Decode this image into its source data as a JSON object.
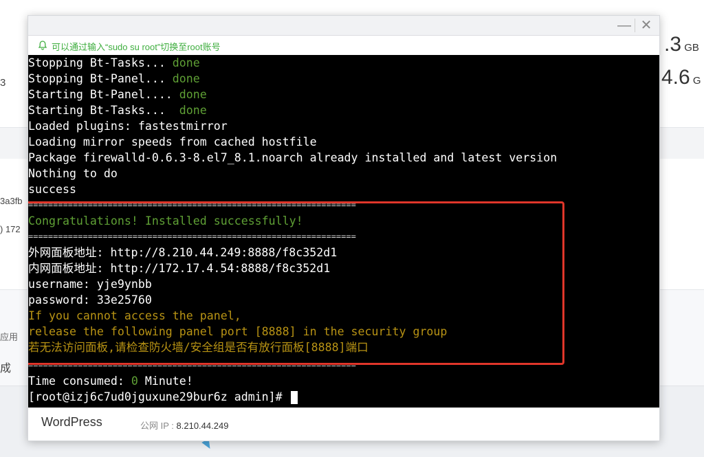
{
  "background": {
    "stat_1_value": ".3",
    "stat_1_unit": "GB",
    "stat_2_value": "4.6",
    "stat_2_unit": "G",
    "left_fragment_1": "3",
    "left_fragment_2": "3a3fb",
    "left_fragment_3": ") 172",
    "left_fragment_4": "应用",
    "left_fragment_5": "成"
  },
  "dialog": {
    "tip_text": "可以通过输入“sudo su root”切换至root账号",
    "min_label": "—",
    "close_label": "✕",
    "terminal": {
      "lines": [
        {
          "text": "Stopping Bt-Tasks... ",
          "status": "done"
        },
        {
          "text": "Stopping Bt-Panel... ",
          "status": "done"
        },
        {
          "text": "Starting Bt-Panel.... ",
          "status": "done"
        },
        {
          "text": "Starting Bt-Tasks...  ",
          "status": "done"
        },
        {
          "text": "Loaded plugins: fastestmirror"
        },
        {
          "text": "Loading mirror speeds from cached hostfile"
        },
        {
          "text": "Package firewalld-0.6.3-8.el7_8.1.noarch already installed and latest version"
        },
        {
          "text": "Nothing to do"
        },
        {
          "text": "success"
        },
        {
          "text": "=================================================================="
        },
        {
          "text": "Congratulations! Installed successfully!"
        },
        {
          "text": "=================================================================="
        },
        {
          "text": "外网面板地址: http://8.210.44.249:8888/f8c352d1"
        },
        {
          "text": "内网面板地址: http://172.17.4.54:8888/f8c352d1"
        },
        {
          "text": "username: yje9ynbb"
        },
        {
          "text": "password: 33e25760"
        },
        {
          "text": "If you cannot access the panel,"
        },
        {
          "text": "release the following panel port [8888] in the security group"
        },
        {
          "text": "若无法访问面板,请检查防火墙/安全组是否有放行面板[8888]端口"
        },
        {
          "text": "=================================================================="
        },
        {
          "text": "Time consumed: ",
          "value": "0",
          "suffix": " Minute!"
        },
        {
          "text": "[root@izj6c7ud0jguxune29bur6z admin]# "
        }
      ]
    },
    "footer": {
      "app_name": "WordPress",
      "ip_label": "公网 IP :",
      "ip_value": "8.210.44.249"
    }
  },
  "colors": {
    "terminal_bg": "#000000",
    "terminal_text": "#ffffff",
    "status_green": "#5fa035",
    "warning_yellow": "#b89314",
    "tip_green": "#3fae3f",
    "highlight_red": "#e0362a"
  }
}
